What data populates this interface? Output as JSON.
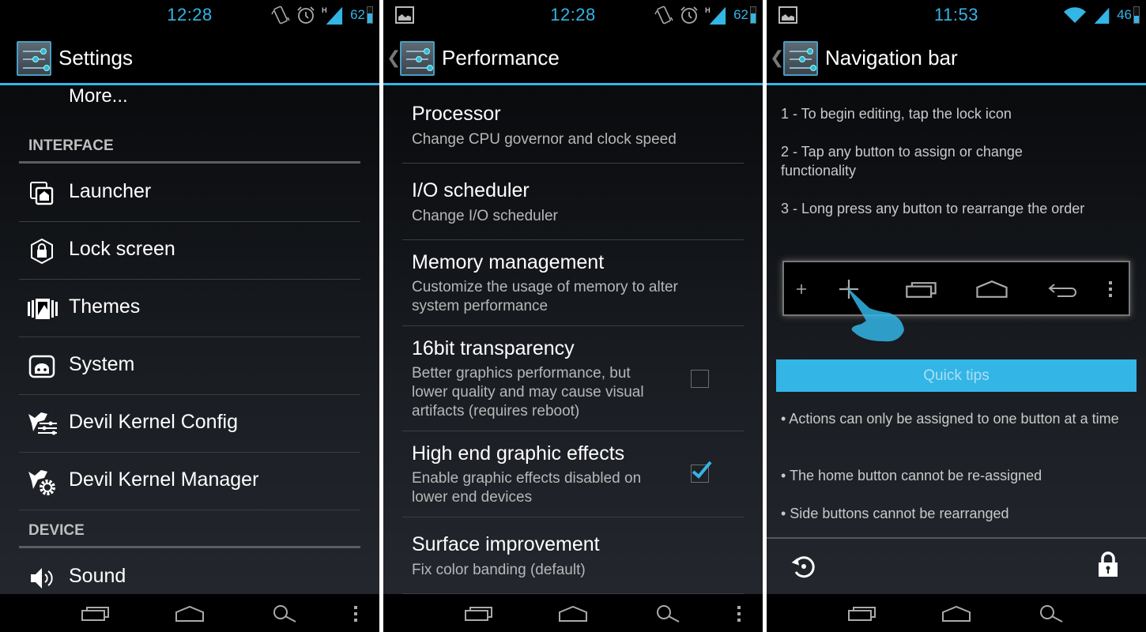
{
  "accent_color": "#33b5e5",
  "panels": [
    {
      "status": {
        "time": "12:28",
        "battery": "62",
        "battery_level": 0.62,
        "icons": [
          "vibrate-icon",
          "alarm-icon",
          "hspa-signal-icon",
          "battery-charging-icon"
        ]
      },
      "title": "Settings",
      "more_item": "More...",
      "sections": [
        {
          "header": "INTERFACE",
          "items": [
            {
              "label": "Launcher",
              "icon": "launcher-icon"
            },
            {
              "label": "Lock screen",
              "icon": "lock-screen-icon"
            },
            {
              "label": "Themes",
              "icon": "themes-icon"
            },
            {
              "label": "System",
              "icon": "system-icon"
            },
            {
              "label": "Devil Kernel Config",
              "icon": "devil-config-icon"
            },
            {
              "label": "Devil Kernel Manager",
              "icon": "devil-manager-icon"
            }
          ]
        },
        {
          "header": "DEVICE",
          "items": [
            {
              "label": "Sound",
              "icon": "sound-icon"
            }
          ]
        }
      ]
    },
    {
      "status": {
        "time": "12:28",
        "battery": "62",
        "battery_level": 0.62
      },
      "title": "Performance",
      "items": [
        {
          "title": "Processor",
          "summary": "Change CPU governor and clock speed"
        },
        {
          "title": "I/O scheduler",
          "summary": "Change I/O scheduler"
        },
        {
          "title": "Memory management",
          "summary": "Customize the usage of memory to alter system performance"
        },
        {
          "title": "16bit transparency",
          "summary": "Better graphics performance, but lower quality and may cause visual artifacts (requires reboot)",
          "checked": false
        },
        {
          "title": "High end graphic effects",
          "summary": "Enable graphic effects disabled on lower end devices",
          "checked": true
        },
        {
          "title": "Surface improvement",
          "summary": "Fix color banding (default)"
        }
      ]
    },
    {
      "status": {
        "time": "11:53",
        "battery": "46",
        "battery_level": 0.46
      },
      "title": "Navigation bar",
      "steps": [
        "1 - To begin editing, tap the lock icon",
        "2 - Tap any button to assign or change functionality",
        "3 - Long press any button to rearrange the order"
      ],
      "preview_buttons": [
        "add-small",
        "add",
        "recent-apps",
        "home",
        "back",
        "menu"
      ],
      "quick_tips_label": "Quick tips",
      "tips": [
        "• Actions can only be assigned to one button at a time",
        "• The home button cannot be re-assigned",
        "• Side buttons cannot be rearranged"
      ]
    }
  ]
}
